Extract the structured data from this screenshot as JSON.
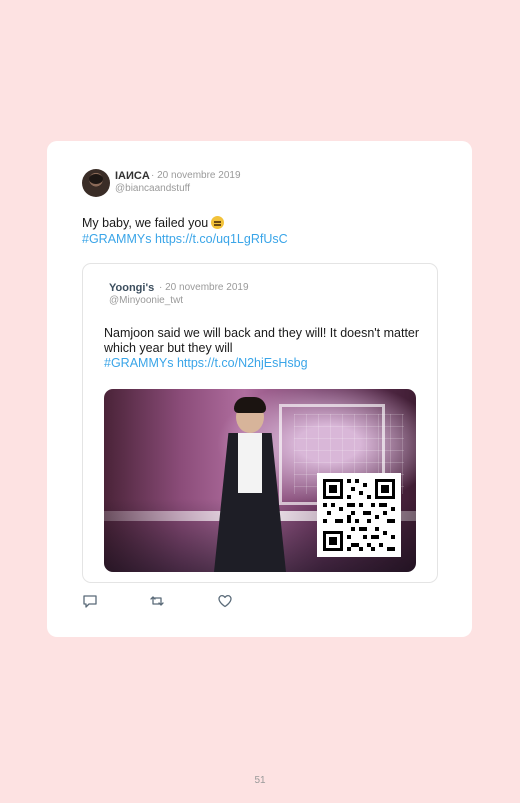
{
  "tweet": {
    "author_name": "IAИCA",
    "date": "· 20 novembre 2019",
    "handle": "@biancaandstuff",
    "text": "My baby, we failed you",
    "emoji": "relieved-face-emoji",
    "hashtag": "#GRAMMYs",
    "url": "https://t.co/uq1LgRfUsC"
  },
  "quoted": {
    "author_name": "Yoongi's",
    "date": "· 20 novembre 2019",
    "handle": "@Minyoonie_twt",
    "text": "Namjoon said we will back and they will! It doesn't matter which year but they will",
    "hashtag": "#GRAMMYs",
    "url": "https://t.co/N2hjEsHsbg"
  },
  "actions": [
    {
      "icon": "reply-icon"
    },
    {
      "icon": "retweet-icon"
    },
    {
      "icon": "like-icon"
    }
  ],
  "page": {
    "number": "51"
  },
  "colors": {
    "background": "#fde2e2",
    "card": "#ffffff",
    "link": "#3aa5e8"
  }
}
